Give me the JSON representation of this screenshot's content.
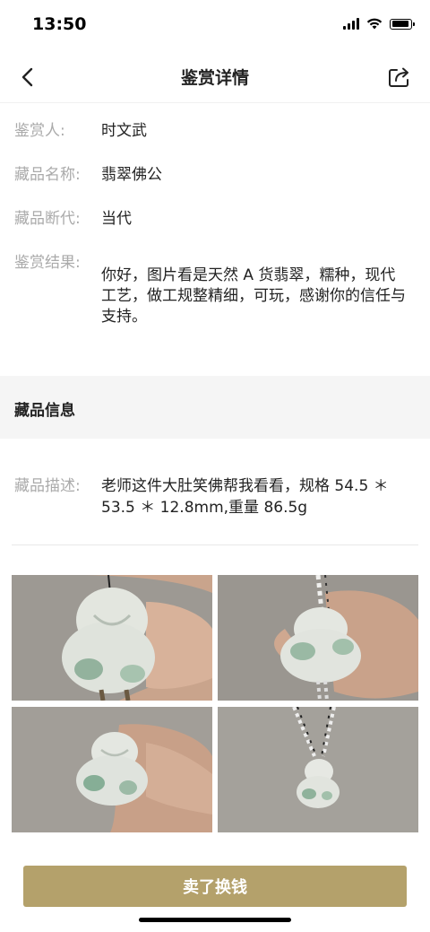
{
  "status_bar": {
    "time": "13:50"
  },
  "header": {
    "title": "鉴赏详情"
  },
  "appraisal": {
    "appraiser_label": "鉴赏人:",
    "appraiser": "时文武",
    "item_name_label": "藏品名称:",
    "item_name": "翡翠佛公",
    "era_label": "藏品断代:",
    "era": "当代",
    "result_label": "鉴赏结果:",
    "result": "你好，图片看是天然 A 货翡翠，糯种，现代工艺，做工规整精细，可玩，感谢你的信任与支持。"
  },
  "collection_info": {
    "section_title": "藏品信息",
    "desc_label": "藏品描述:",
    "desc": "老师这件大肚笑佛帮我看看，规格 54.5 ＊ 53.5 ＊ 12.8mm,重量 86.5g"
  },
  "photos": [
    "jade-buddha-front",
    "jade-buddha-back",
    "jade-buddha-in-hand",
    "jade-buddha-hanging"
  ],
  "bottom": {
    "cta_label": "卖了换钱"
  },
  "colors": {
    "accent": "#b4a16b",
    "label_gray": "#aaaaaa",
    "section_bg": "#f5f5f5"
  }
}
